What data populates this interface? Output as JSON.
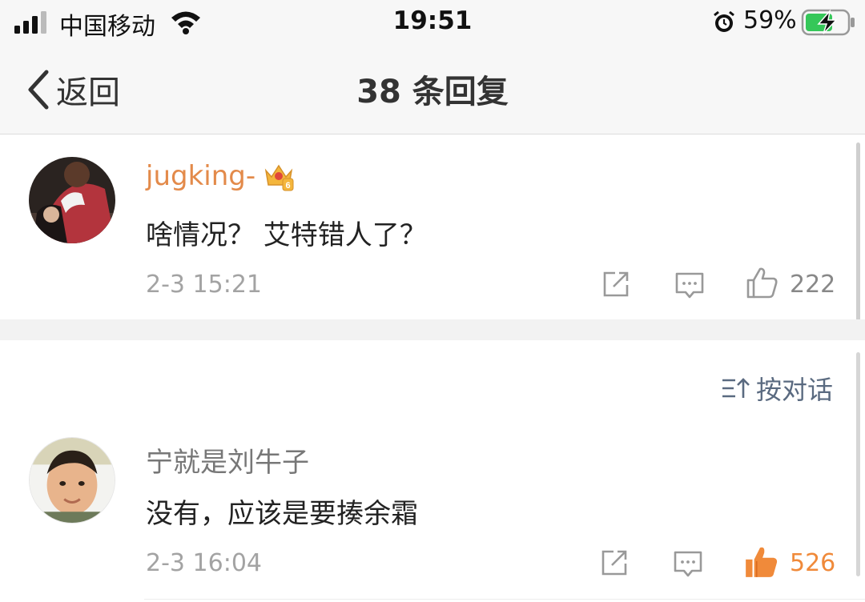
{
  "status_bar": {
    "carrier": "中国移动",
    "time": "19:51",
    "battery": "59%"
  },
  "nav": {
    "back_label": "返回",
    "title": "38 条回复"
  },
  "comments": [
    {
      "username": "jugking-",
      "username_color": "#e38a4a",
      "badge": "crown-level-6",
      "text": "啥情况？ 艾特错人了？",
      "time": "2-3 15:21",
      "likes": "222",
      "liked": false
    },
    {
      "username": "宁就是刘牛子",
      "username_color": "#777777",
      "text": "没有，应该是要揍余霜",
      "time": "2-3 16:04",
      "likes": "526",
      "liked": true
    }
  ],
  "dialog_link": "按对话",
  "colors": {
    "accent_orange": "#f08a3a",
    "link_blue_gray": "#5a6a80"
  }
}
